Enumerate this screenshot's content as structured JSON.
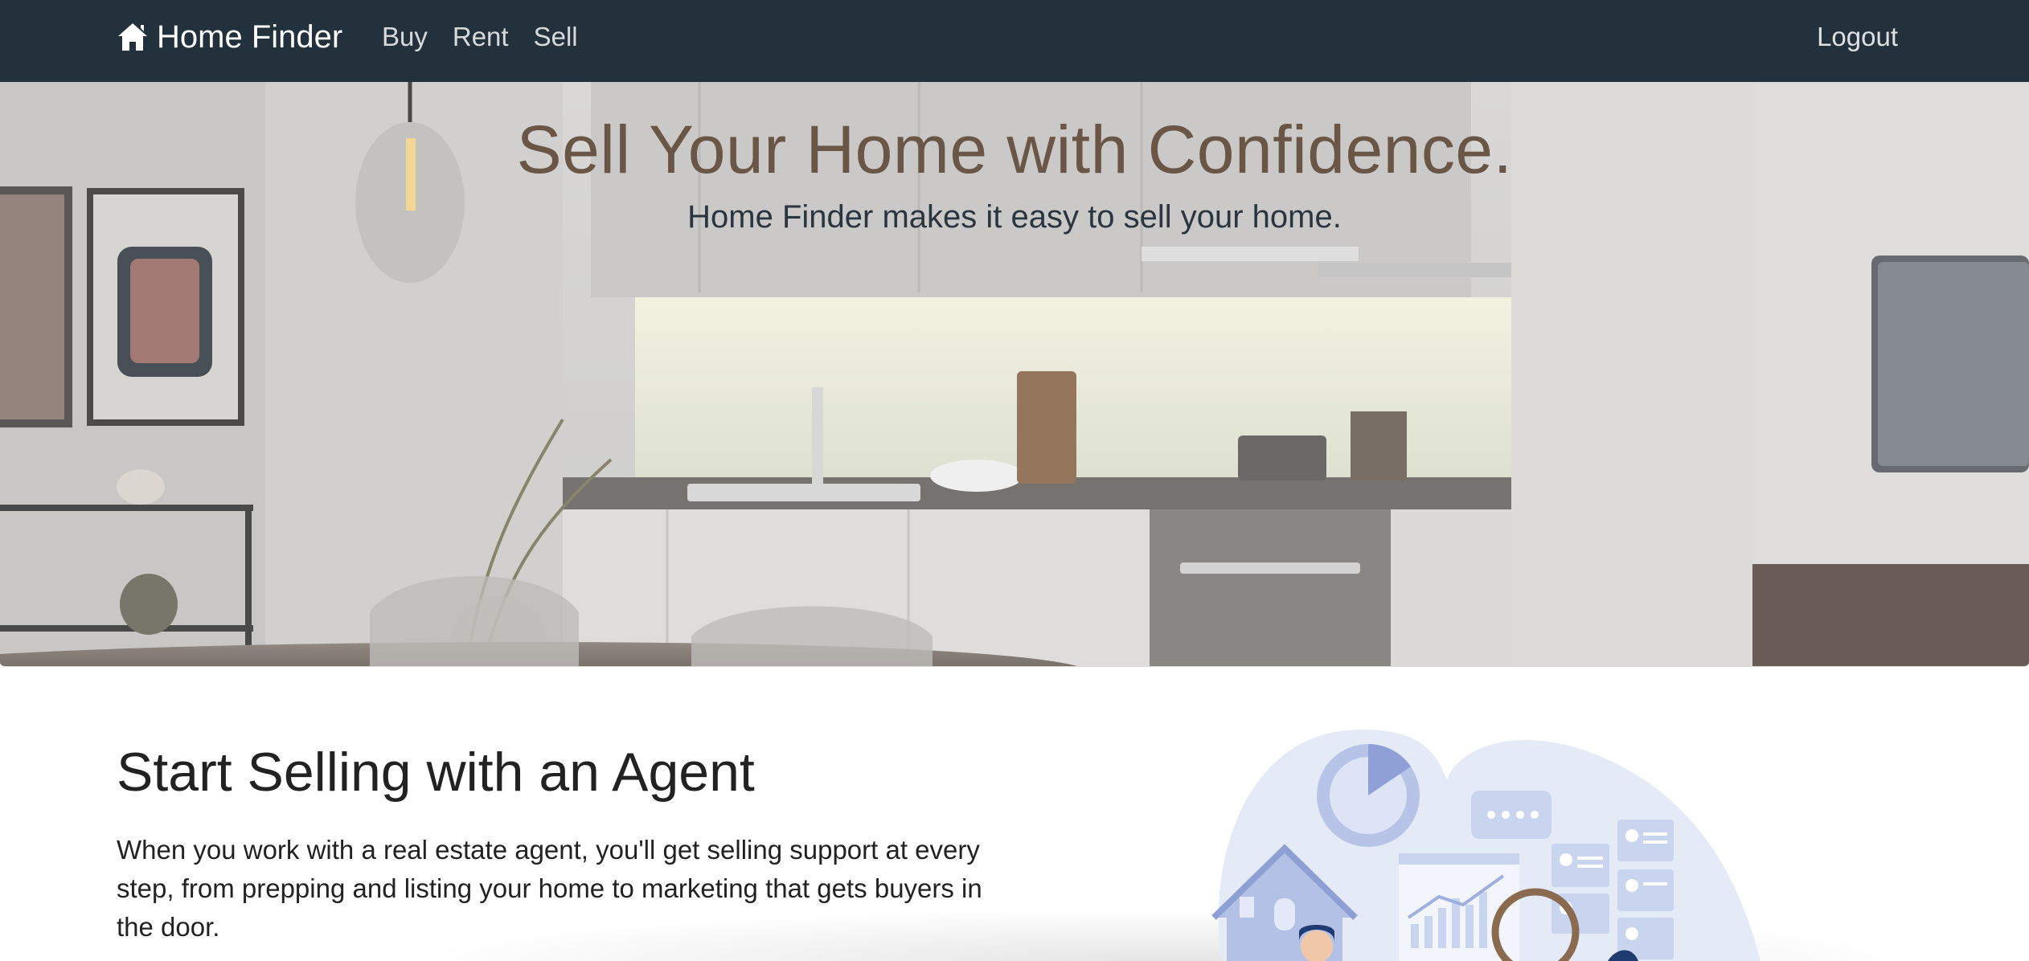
{
  "navbar": {
    "brand": "Home Finder",
    "brand_icon": "home-icon",
    "links": [
      "Buy",
      "Rent",
      "Sell"
    ],
    "logout": "Logout",
    "background": "#22313b"
  },
  "hero": {
    "title": "Sell Your Home with Confidence.",
    "subtitle": "Home Finder makes it easy to sell your home.",
    "title_color": "#6a5646"
  },
  "section": {
    "title": "Start Selling with an Agent",
    "text": "When you work with a real estate agent, you'll get selling support at every step, from prepping and listing your home to marketing that gets buyers in the door."
  },
  "colors": {
    "illustration_blue": "#c9d4ef",
    "illustration_accent": "#8a6b4f"
  }
}
